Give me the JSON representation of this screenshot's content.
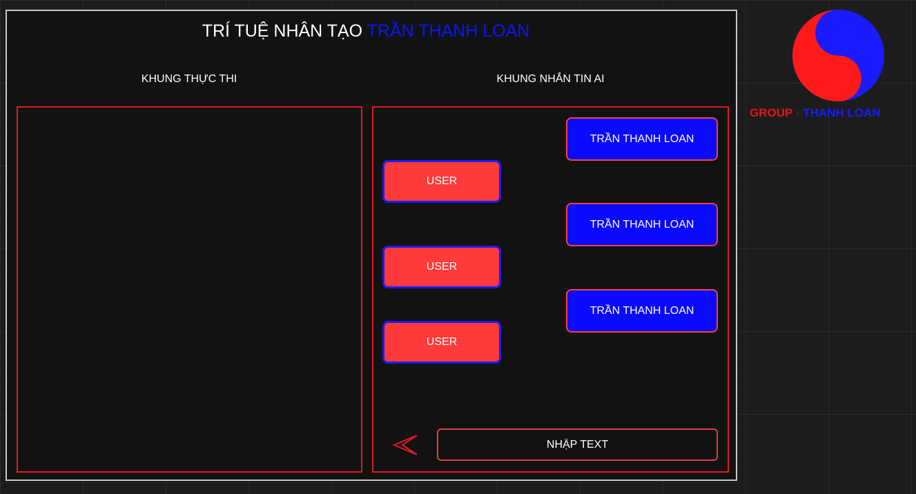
{
  "header": {
    "title_prefix": "TRÍ TUỆ NHÂN TẠO",
    "title_accent": "TRẦN THANH LOAN"
  },
  "sections": {
    "execution_label": "KHUNG THỰC THI",
    "chat_label": "KHUNG NHẮN TIN AI"
  },
  "chat": {
    "ai_messages": [
      {
        "label": "TRẦN THANH LOAN"
      },
      {
        "label": "TRẦN THANH LOAN"
      },
      {
        "label": "TRẦN THANH LOAN"
      }
    ],
    "user_messages": [
      {
        "label": "USER"
      },
      {
        "label": "USER"
      },
      {
        "label": "USER"
      }
    ],
    "input": {
      "placeholder": "NHẬP TEXT",
      "value": ""
    },
    "send_icon": "chevron-left-icon"
  },
  "brand": {
    "group": "GROUP",
    "separator": "-",
    "name": "THANH LOAN",
    "logo_icon": "yin-yang-icon"
  },
  "colors": {
    "background": "#121212",
    "frame_border": "#c8c8c8",
    "panel_border": "#e21a26",
    "accent_blue": "#0a16ff",
    "user_bubble": "#ff3a3a",
    "ai_bubble": "#0a0afc"
  }
}
